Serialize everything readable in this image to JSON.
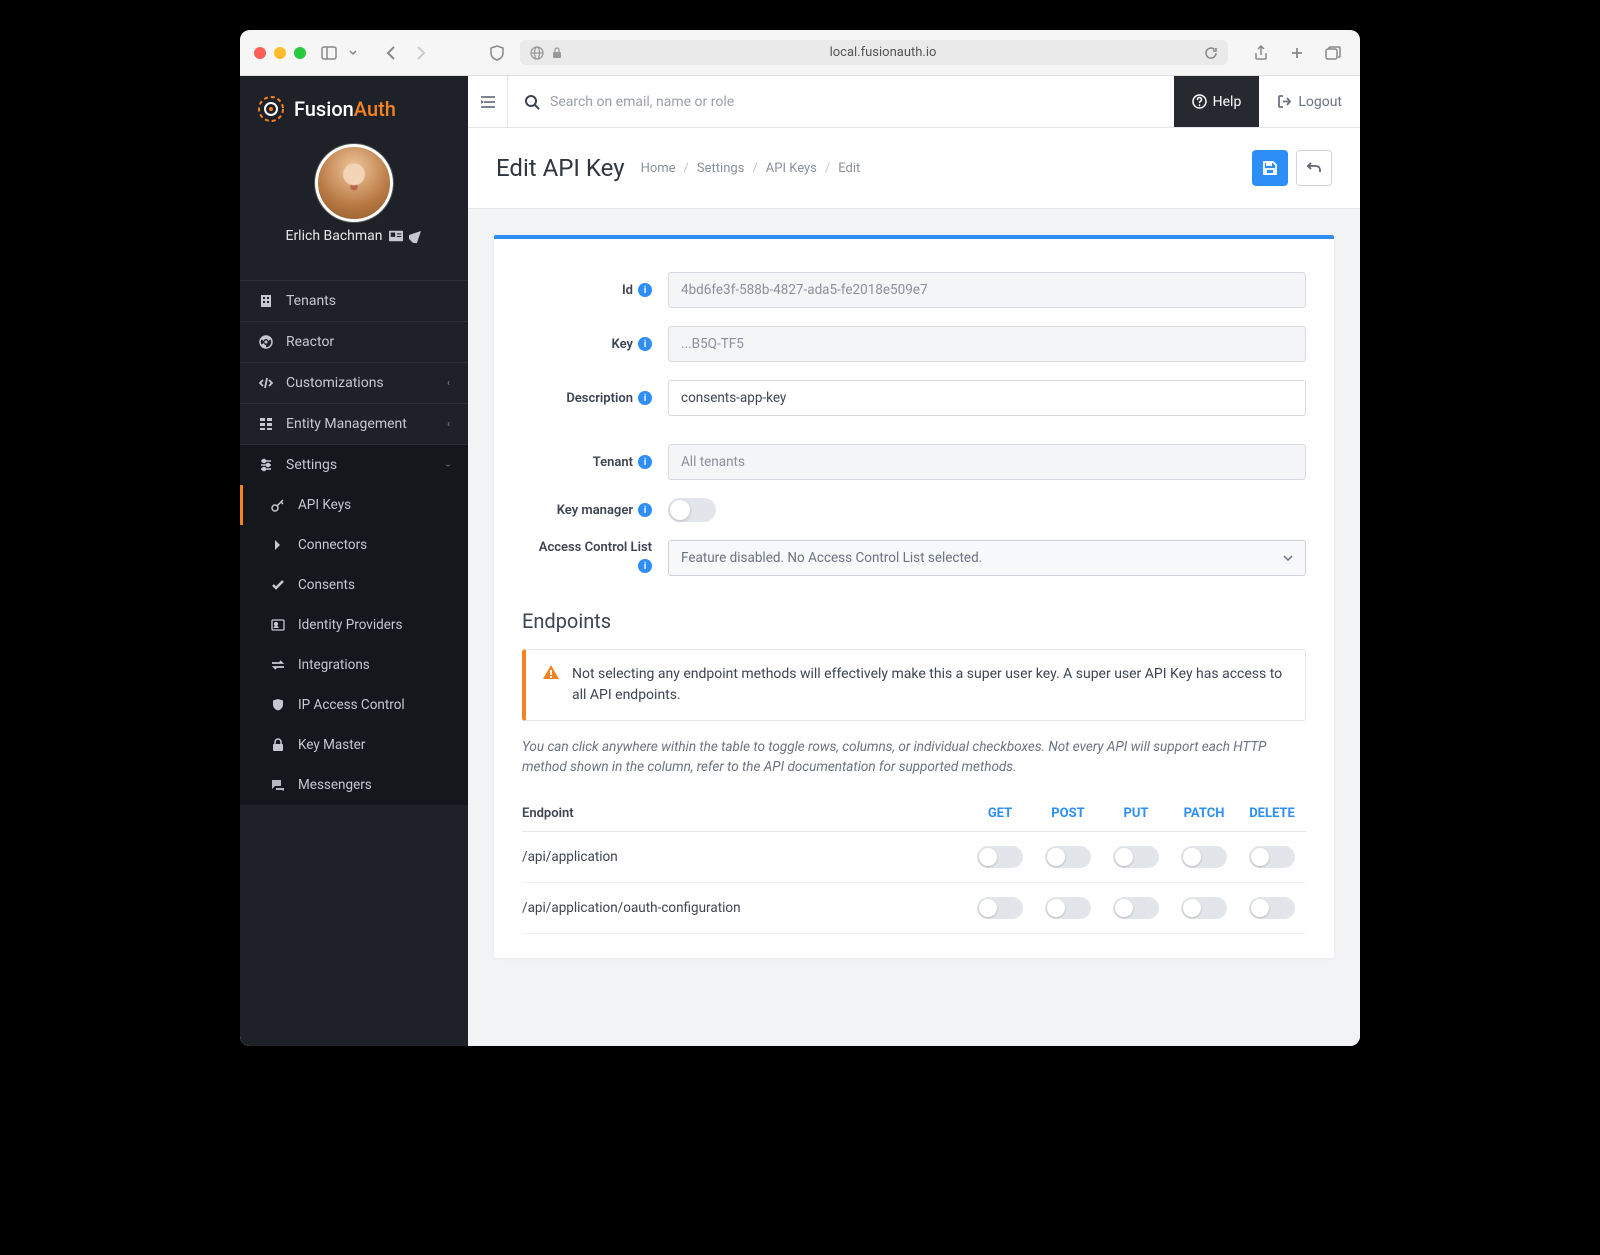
{
  "browser": {
    "url": "local.fusionauth.io"
  },
  "logo": {
    "part1": "Fusion",
    "part2": "Auth"
  },
  "user": {
    "name": "Erlich Bachman"
  },
  "nav": {
    "tenants": "Tenants",
    "reactor": "Reactor",
    "customizations": "Customizations",
    "entity_management": "Entity Management",
    "settings": "Settings",
    "sub": {
      "api_keys": "API Keys",
      "connectors": "Connectors",
      "consents": "Consents",
      "identity_providers": "Identity Providers",
      "integrations": "Integrations",
      "ip_access_control": "IP Access Control",
      "key_master": "Key Master",
      "messengers": "Messengers"
    }
  },
  "topbar": {
    "search_placeholder": "Search on email, name or role",
    "help": "Help",
    "logout": "Logout"
  },
  "header": {
    "title": "Edit API Key",
    "crumbs": {
      "home": "Home",
      "settings": "Settings",
      "api_keys": "API Keys",
      "edit": "Edit"
    }
  },
  "form": {
    "labels": {
      "id": "Id",
      "key": "Key",
      "description": "Description",
      "tenant": "Tenant",
      "key_manager": "Key manager",
      "acl": "Access Control List"
    },
    "values": {
      "id": "4bd6fe3f-588b-4827-ada5-fe2018e509e7",
      "key": "...B5Q-TF5",
      "description": "consents-app-key",
      "tenant": "All tenants",
      "acl": "Feature disabled. No Access Control List selected."
    }
  },
  "endpoints": {
    "title": "Endpoints",
    "alert": "Not selecting any endpoint methods will effectively make this a super user key. A super user API Key has access to all API endpoints.",
    "note": "You can click anywhere within the table to toggle rows, columns, or individual checkboxes. Not every API will support each HTTP method shown in the column, refer to the API documentation for supported methods.",
    "columns": {
      "endpoint": "Endpoint",
      "get": "GET",
      "post": "POST",
      "put": "PUT",
      "patch": "PATCH",
      "delete": "DELETE"
    },
    "rows": [
      {
        "path": "/api/application"
      },
      {
        "path": "/api/application/oauth-configuration"
      }
    ]
  }
}
